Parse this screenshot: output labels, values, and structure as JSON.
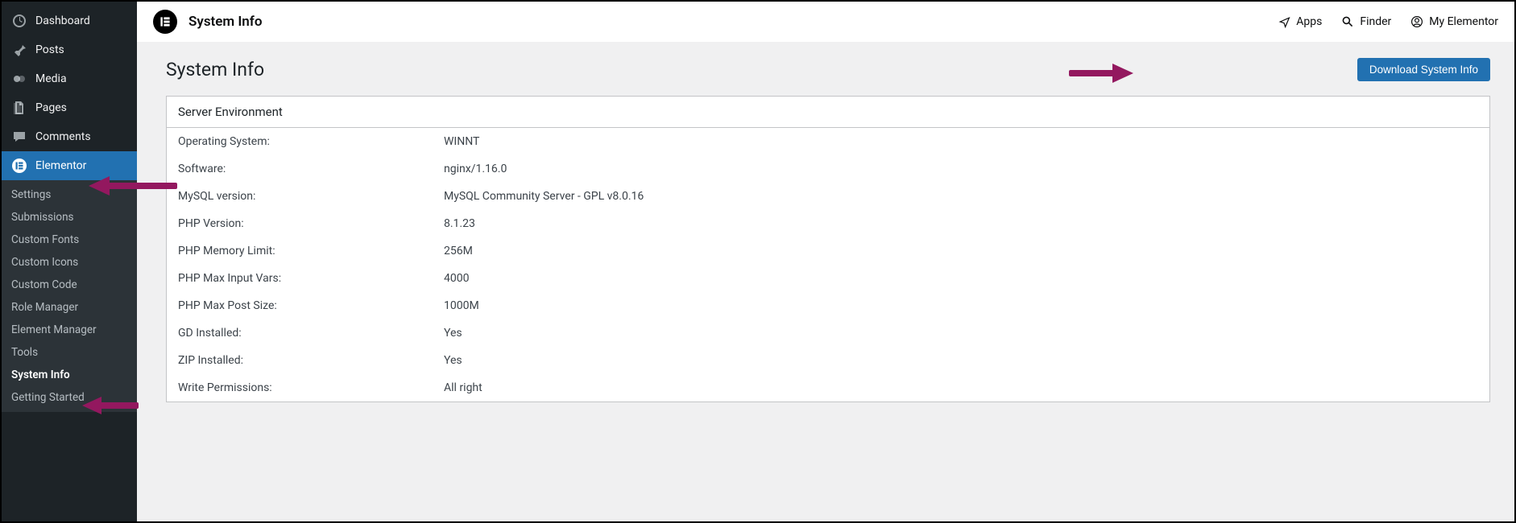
{
  "sidebar": {
    "items": [
      {
        "label": "Dashboard"
      },
      {
        "label": "Posts"
      },
      {
        "label": "Media"
      },
      {
        "label": "Pages"
      },
      {
        "label": "Comments"
      },
      {
        "label": "Elementor"
      }
    ],
    "sub": [
      {
        "label": "Settings"
      },
      {
        "label": "Submissions"
      },
      {
        "label": "Custom Fonts"
      },
      {
        "label": "Custom Icons"
      },
      {
        "label": "Custom Code"
      },
      {
        "label": "Role Manager"
      },
      {
        "label": "Element Manager"
      },
      {
        "label": "Tools"
      },
      {
        "label": "System Info"
      },
      {
        "label": "Getting Started"
      }
    ]
  },
  "topbar": {
    "title": "System Info",
    "links": {
      "apps": "Apps",
      "finder": "Finder",
      "my_elementor": "My Elementor"
    }
  },
  "page": {
    "heading": "System Info",
    "download_label": "Download System Info"
  },
  "panel": {
    "title": "Server Environment",
    "rows": [
      {
        "label": "Operating System:",
        "value": "WINNT"
      },
      {
        "label": "Software:",
        "value": "nginx/1.16.0"
      },
      {
        "label": "MySQL version:",
        "value": "MySQL Community Server - GPL v8.0.16"
      },
      {
        "label": "PHP Version:",
        "value": "8.1.23"
      },
      {
        "label": "PHP Memory Limit:",
        "value": "256M"
      },
      {
        "label": "PHP Max Input Vars:",
        "value": "4000"
      },
      {
        "label": "PHP Max Post Size:",
        "value": "1000M"
      },
      {
        "label": "GD Installed:",
        "value": "Yes"
      },
      {
        "label": "ZIP Installed:",
        "value": "Yes"
      },
      {
        "label": "Write Permissions:",
        "value": "All right"
      }
    ]
  }
}
